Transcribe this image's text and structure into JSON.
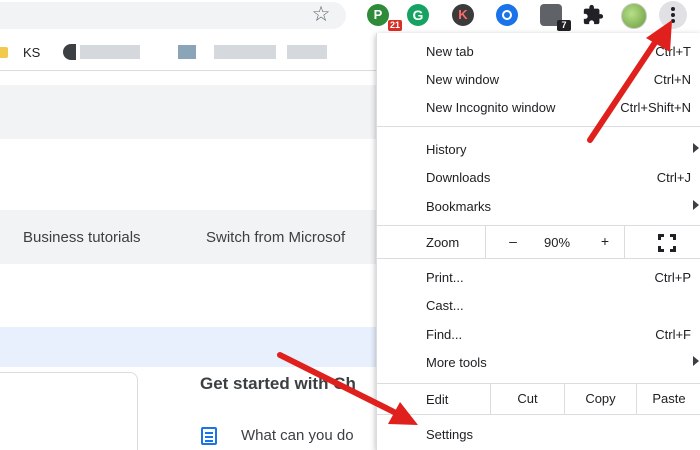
{
  "toolbar": {
    "bookmark_star": "☆",
    "extensions": [
      {
        "name": "p-extension-icon",
        "letter": "P",
        "badge": "21"
      },
      {
        "name": "g-extension-icon",
        "letter": "G"
      },
      {
        "name": "k-extension-icon",
        "letter": "K"
      },
      {
        "name": "blue-extension-icon"
      },
      {
        "name": "bag-extension-icon",
        "badge": "7"
      }
    ]
  },
  "bookmarks": {
    "ks_label": "KS"
  },
  "page": {
    "nav_business": "Business tutorials",
    "nav_switch": "Switch from Microsof",
    "get_started": "Get started with Ch",
    "what_can": "What can you do"
  },
  "menu": {
    "new_tab": {
      "label": "New tab",
      "shortcut": "Ctrl+T"
    },
    "new_window": {
      "label": "New window",
      "shortcut": "Ctrl+N"
    },
    "new_incognito": {
      "label": "New Incognito window",
      "shortcut": "Ctrl+Shift+N"
    },
    "history": {
      "label": "History"
    },
    "downloads": {
      "label": "Downloads",
      "shortcut": "Ctrl+J"
    },
    "bookmarks": {
      "label": "Bookmarks"
    },
    "zoom": {
      "label": "Zoom",
      "minus": "–",
      "value": "90%",
      "plus": "+"
    },
    "print": {
      "label": "Print...",
      "shortcut": "Ctrl+P"
    },
    "cast": {
      "label": "Cast..."
    },
    "find": {
      "label": "Find...",
      "shortcut": "Ctrl+F"
    },
    "more_tools": {
      "label": "More tools"
    },
    "edit": {
      "label": "Edit",
      "cut": "Cut",
      "copy": "Copy",
      "paste": "Paste"
    },
    "settings": {
      "label": "Settings"
    }
  },
  "colors": {
    "annotation_arrow": "#e0201c",
    "menu_background": "#ffffff",
    "separator": "#dadce0"
  }
}
